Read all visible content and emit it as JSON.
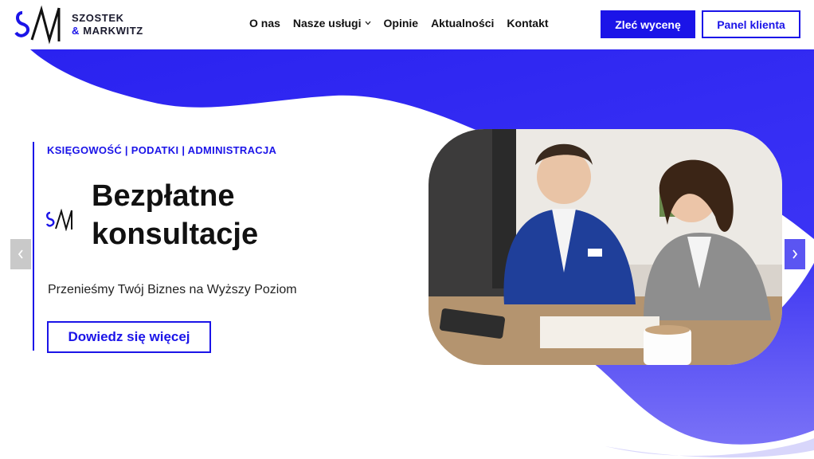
{
  "brand": {
    "line1": "SZOSTEK",
    "amp": "&",
    "line2": "MARKWITZ"
  },
  "nav": {
    "items": [
      {
        "label": "O nas"
      },
      {
        "label": "Nasze usługi"
      },
      {
        "label": "Opinie"
      },
      {
        "label": "Aktualności"
      },
      {
        "label": "Kontakt"
      }
    ]
  },
  "header": {
    "quote_label": "Zleć wycenę",
    "panel_label": "Panel klienta"
  },
  "hero": {
    "tagline": "KSIĘGOWOŚĆ | PODATKI | ADMINISTRACJA",
    "headline_line1": "Bezpłatne",
    "headline_line2": "konsultacje",
    "subtitle": "Przenieśmy Twój Biznes na Wyższy Poziom",
    "cta_label": "Dowiedz się więcej"
  },
  "colors": {
    "accent": "#1b14e8",
    "wave": "#1f1aef",
    "wave_light": "#6e66f5"
  },
  "icons": {
    "prev": "chevron-left-icon",
    "next": "chevron-right-icon",
    "dropdown": "chevron-down-icon"
  }
}
